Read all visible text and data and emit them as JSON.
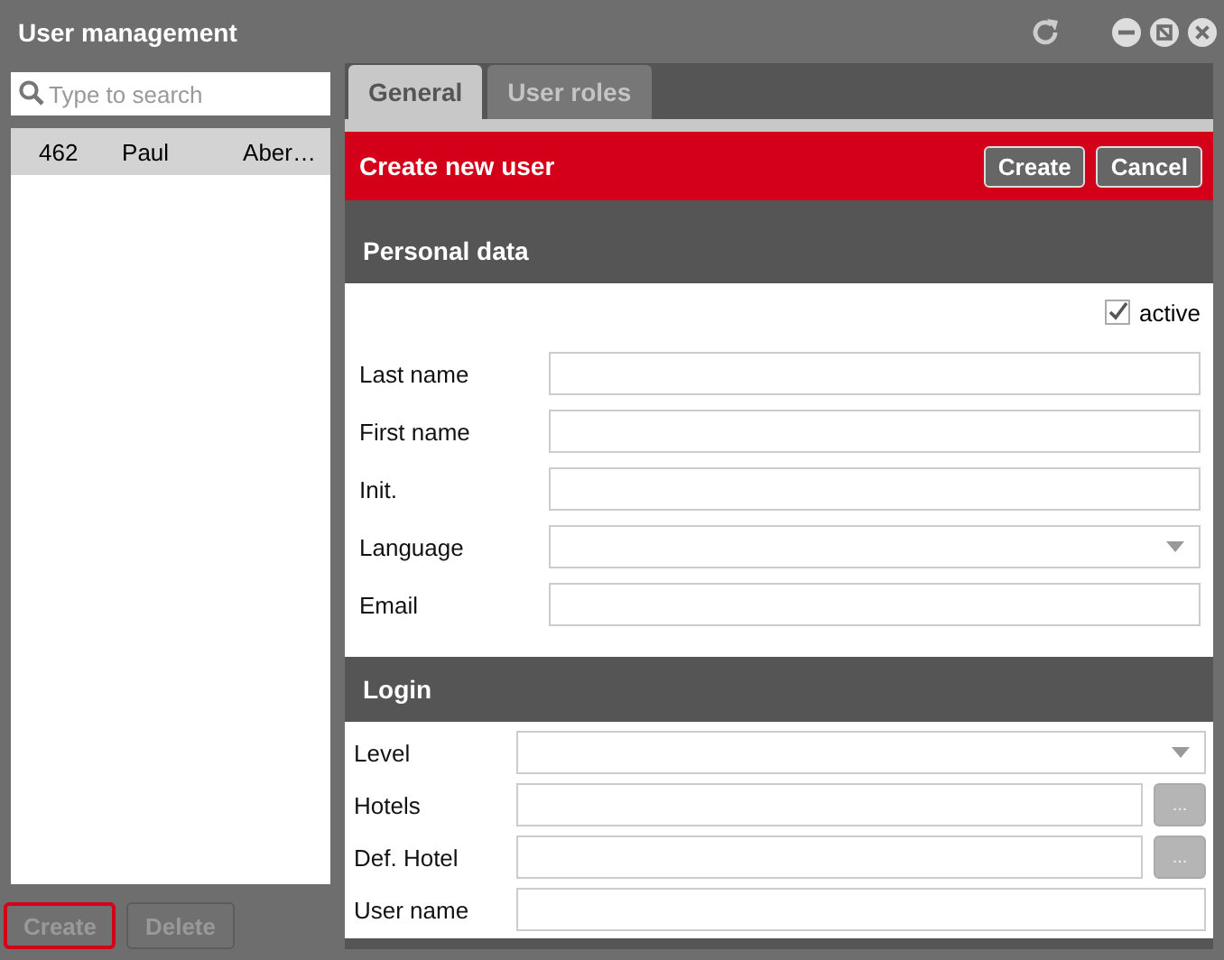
{
  "window": {
    "title": "User management"
  },
  "search": {
    "placeholder": "Type to search"
  },
  "users": [
    {
      "cells": [
        "462",
        "Paul",
        "Aber…"
      ],
      "selected": true
    }
  ],
  "left_buttons": [
    {
      "label": "Create",
      "disabled": true,
      "focused": true
    },
    {
      "label": "Delete",
      "disabled": true,
      "focused": false
    }
  ],
  "tabs": [
    {
      "label": "General",
      "selected": true
    },
    {
      "label": "User roles",
      "selected": false
    }
  ],
  "banner": {
    "title": "Create new user",
    "buttons": [
      "Create",
      "Cancel"
    ]
  },
  "sections": [
    {
      "title": "Personal data",
      "active": {
        "label": "active",
        "checked": true
      },
      "fields": [
        {
          "label": "Last name",
          "kind": "text"
        },
        {
          "label": "First name",
          "kind": "text"
        },
        {
          "label": "Init.",
          "kind": "text"
        },
        {
          "label": "Language",
          "kind": "select"
        },
        {
          "label": "Email",
          "kind": "text"
        }
      ]
    },
    {
      "title": "Login",
      "fields": [
        {
          "label": "Level",
          "kind": "select"
        },
        {
          "label": "Hotels",
          "kind": "picker",
          "button": "..."
        },
        {
          "label": "Def. Hotel",
          "kind": "picker",
          "button": "..."
        },
        {
          "label": "User name",
          "kind": "text"
        }
      ]
    }
  ]
}
